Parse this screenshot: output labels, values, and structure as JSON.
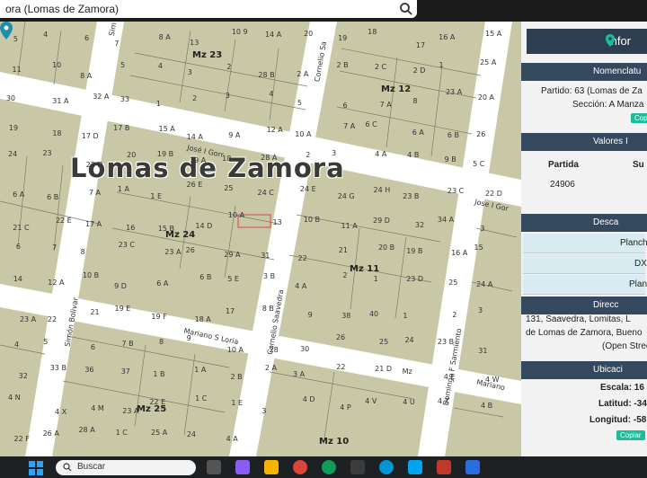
{
  "search": {
    "value": "ora (Lomas de Zamora)"
  },
  "map": {
    "city_label": "Lomas de Zamora",
    "manzanas": [
      "Mz 23",
      "Mz 12",
      "Mz 24",
      "Mz 11",
      "Mz 25",
      "Mz 10"
    ],
    "streets": [
      "José I Gorr",
      "Jose I Gor",
      "Simón Bolivar",
      "Mariano S Loria",
      "Cornelio Saavedra",
      "Cornelio Sa",
      "Domingo F Sarmiento",
      "Mariano",
      "Sim"
    ],
    "parcels": [
      "5",
      "4",
      "6",
      "7",
      "8 A",
      "13",
      "10 9",
      "14 A",
      "20",
      "19",
      "18",
      "17",
      "16 A",
      "15 A",
      "11",
      "10",
      "8 A",
      "5",
      "4",
      "3",
      "2",
      "28 B",
      "2 A",
      "2 B",
      "2 C",
      "2 D",
      "1",
      "25 A",
      "30",
      "31 A",
      "32 A",
      "33",
      "1",
      "2",
      "3",
      "4",
      "5",
      "6",
      "7 A",
      "8",
      "23 A",
      "20 A",
      "19",
      "18",
      "17 D",
      "17 B",
      "15 A",
      "14 A",
      "9 A",
      "12 A",
      "10 A",
      "7 A",
      "6 C",
      "6 A",
      "6 B",
      "26",
      "24",
      "23",
      "22 D",
      "20",
      "19 B",
      "19 A",
      "18",
      "28 A",
      "2",
      "3",
      "4 A",
      "4 B",
      "9 B",
      "5 C",
      "6 A",
      "6 B",
      "7 A",
      "1 A",
      "1 E",
      "26 E",
      "25",
      "24 C",
      "24 E",
      "24 G",
      "24 H",
      "23 B",
      "23 C",
      "22 D",
      "21 C",
      "22 E",
      "17 A",
      "16",
      "15 B",
      "14 D",
      "10 A",
      "13",
      "10 B",
      "11 A",
      "29 D",
      "32",
      "34 A",
      "3",
      "6",
      "7",
      "8",
      "23 C",
      "23 A",
      "26",
      "29 A",
      "31",
      "22",
      "21",
      "20 B",
      "19 B",
      "16 A",
      "15",
      "14",
      "12 A",
      "10 B",
      "9 D",
      "6 A",
      "6 B",
      "5 E",
      "3 B",
      "4 A",
      "2",
      "1",
      "23 D",
      "25",
      "24 A",
      "23 A",
      "22",
      "21",
      "19 E",
      "19 F",
      "18 A",
      "17",
      "8 B",
      "9",
      "38",
      "40",
      "1",
      "2",
      "3",
      "4",
      "5",
      "6",
      "7 B",
      "8",
      "9",
      "10 A",
      "28",
      "30",
      "26",
      "25",
      "24",
      "23 B",
      "31",
      "32",
      "33 B",
      "36",
      "37",
      "1 B",
      "1 A",
      "2 B",
      "2 A",
      "3 A",
      "22",
      "21 D",
      "Mz",
      "4 E",
      "4 W",
      "4 N",
      "4 X",
      "4 M",
      "23 A",
      "22 E",
      "1 C",
      "1 E",
      "3",
      "4 D",
      "4 P",
      "4 V",
      "4 U",
      "4 Z",
      "4 B",
      "22 F",
      "26 A",
      "28 A",
      "1 C",
      "25 A",
      "24",
      "4 A"
    ]
  },
  "panel": {
    "header": "Infor",
    "nomenclatura": {
      "title": "Nomenclatu",
      "partido": "Partido: 63 (Lomas de Za",
      "seccion": "Sección: A Manza",
      "copy_label": "Cop"
    },
    "valores": {
      "title": "Valores I",
      "col_partida": "Partida",
      "col_sup": "Su",
      "partida_value": "24906"
    },
    "descargas": {
      "title": "Desca",
      "items": [
        "Planch",
        "DXF",
        "Planc"
      ]
    },
    "direccion": {
      "title": "Direcc",
      "line1": "131, Saavedra, Lomitas, L",
      "line2": "de Lomas de Zamora, Bueno",
      "line3": "(Open Stree"
    },
    "ubicacion": {
      "title": "Ubicaci",
      "escala_label": "Escala: 16",
      "latitud_label": "Latitud: -34",
      "longitud_label": "Longitud: -58",
      "copy_label": "Copiar"
    }
  },
  "taskbar": {
    "search_placeholder": "Buscar"
  }
}
